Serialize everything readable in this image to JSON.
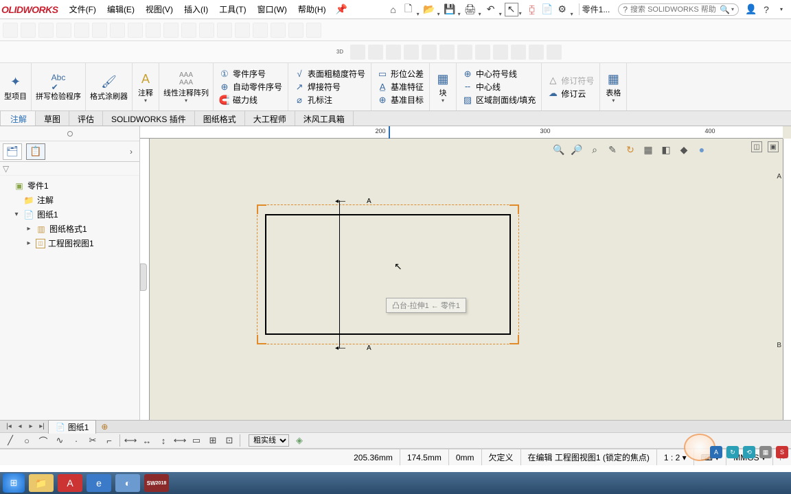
{
  "app": {
    "logo": "OLIDWORKS"
  },
  "menu": {
    "file": "文件(F)",
    "edit": "编辑(E)",
    "view": "视图(V)",
    "insert": "插入(I)",
    "tools": "工具(T)",
    "window": "窗口(W)",
    "help": "帮助(H)"
  },
  "doc_label": "零件1...",
  "search": {
    "placeholder": "搜索 SOLIDWORKS 帮助"
  },
  "ribbon": {
    "model_items": "型项目",
    "spell": "拼写检验程序",
    "format_painter": "格式涂刷器",
    "note": "注释",
    "linear_pattern": "线性注释阵列",
    "balloon": "零件序号",
    "auto_balloon": "自动零件序号",
    "magnetic_line": "磁力线",
    "surface_finish": "表面粗糙度符号",
    "weld_symbol": "焊接符号",
    "hole_callout": "孔标注",
    "geo_tol": "形位公差",
    "datum_feature": "基准特征",
    "datum_target": "基准目标",
    "block": "块",
    "center_mark": "中心符号线",
    "centerline": "中心线",
    "area_hatch": "区域剖面线/填充",
    "rev_symbol": "修订符号",
    "rev_cloud": "修订云",
    "tables": "表格"
  },
  "tabs": {
    "annotation": "注解",
    "sketch": "草图",
    "evaluate": "评估",
    "addins": "SOLIDWORKS 插件",
    "sheet_format": "图纸格式",
    "engineer": "大工程师",
    "mufeng": "沐风工具箱"
  },
  "ruler": {
    "t200": "200",
    "t300": "300",
    "t400": "400",
    "ra": "A",
    "rb": "B"
  },
  "tree": {
    "root": "零件1",
    "annotations": "注解",
    "sheet1": "图纸1",
    "sheet_format1": "图纸格式1",
    "view1": "工程图视图1"
  },
  "canvas": {
    "section_label_top": "A",
    "section_label_bot": "A",
    "tooltip": "凸台-拉伸1 ← 零件1"
  },
  "sheet_tab": {
    "name": "图纸1"
  },
  "drawtools": {
    "linestyle": "粗实线"
  },
  "status": {
    "x": "205.36mm",
    "y": "174.5mm",
    "z": "0mm",
    "under": "欠定义",
    "editing": "在编辑 工程图视图1 (锁定的焦点)",
    "scale": "1 : 2",
    "units": "MMGS"
  },
  "taskbar": {
    "sw_year": "2018"
  }
}
